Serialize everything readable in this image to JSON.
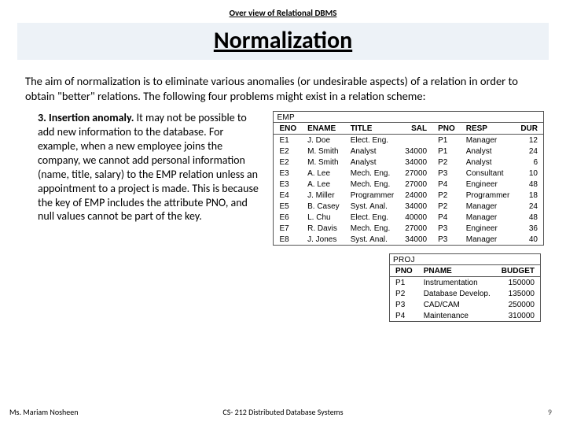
{
  "header": {
    "overview": "Over view of Relational DBMS"
  },
  "title": "Normalization",
  "intro": "The aim of normalization is to eliminate various anomalies (or undesirable aspects) of a relation in order to obtain \"better\" relations. The following four problems might exist in a relation scheme:",
  "anomaly": {
    "lead": "3. Insertion anomaly.",
    "body": " It may not be possible to add new information to the database. For example, when a new employee joins the company, we cannot add personal information (name, title, salary) to the EMP relation unless an appointment to a project is made. This is because the key of EMP includes the attribute PNO, and null values cannot be part of the key."
  },
  "emp": {
    "caption": "EMP",
    "headers": [
      "ENO",
      "ENAME",
      "TITLE",
      "SAL",
      "PNO",
      "RESP",
      "DUR"
    ],
    "rows": [
      [
        "E1",
        "J. Doe",
        "Elect. Eng.",
        "",
        "P1",
        "Manager",
        "12"
      ],
      [
        "E2",
        "M. Smith",
        "Analyst",
        "34000",
        "P1",
        "Analyst",
        "24"
      ],
      [
        "E2",
        "M. Smith",
        "Analyst",
        "34000",
        "P2",
        "Analyst",
        "6"
      ],
      [
        "E3",
        "A. Lee",
        "Mech. Eng.",
        "27000",
        "P3",
        "Consultant",
        "10"
      ],
      [
        "E3",
        "A. Lee",
        "Mech. Eng.",
        "27000",
        "P4",
        "Engineer",
        "48"
      ],
      [
        "E4",
        "J. Miller",
        "Programmer",
        "24000",
        "P2",
        "Programmer",
        "18"
      ],
      [
        "E5",
        "B. Casey",
        "Syst. Anal.",
        "34000",
        "P2",
        "Manager",
        "24"
      ],
      [
        "E6",
        "L. Chu",
        "Elect. Eng.",
        "40000",
        "P4",
        "Manager",
        "48"
      ],
      [
        "E7",
        "R. Davis",
        "Mech. Eng.",
        "27000",
        "P3",
        "Engineer",
        "36"
      ],
      [
        "E8",
        "J. Jones",
        "Syst. Anal.",
        "34000",
        "P3",
        "Manager",
        "40"
      ]
    ]
  },
  "proj": {
    "caption": "PROJ",
    "headers": [
      "PNO",
      "PNAME",
      "BUDGET"
    ],
    "rows": [
      [
        "P1",
        "Instrumentation",
        "150000"
      ],
      [
        "P2",
        "Database Develop.",
        "135000"
      ],
      [
        "P3",
        "CAD/CAM",
        "250000"
      ],
      [
        "P4",
        "Maintenance",
        "310000"
      ]
    ]
  },
  "footer": {
    "left": "Ms. Mariam Nosheen",
    "center": "CS- 212 Distributed Database Systems",
    "pageno": "9"
  },
  "chart_data": [
    {
      "type": "table",
      "title": "EMP",
      "headers": [
        "ENO",
        "ENAME",
        "TITLE",
        "SAL",
        "PNO",
        "RESP",
        "DUR"
      ],
      "rows": [
        [
          "E1",
          "J. Doe",
          "Elect. Eng.",
          null,
          "P1",
          "Manager",
          12
        ],
        [
          "E2",
          "M. Smith",
          "Analyst",
          34000,
          "P1",
          "Analyst",
          24
        ],
        [
          "E2",
          "M. Smith",
          "Analyst",
          34000,
          "P2",
          "Analyst",
          6
        ],
        [
          "E3",
          "A. Lee",
          "Mech. Eng.",
          27000,
          "P3",
          "Consultant",
          10
        ],
        [
          "E3",
          "A. Lee",
          "Mech. Eng.",
          27000,
          "P4",
          "Engineer",
          48
        ],
        [
          "E4",
          "J. Miller",
          "Programmer",
          24000,
          "P2",
          "Programmer",
          18
        ],
        [
          "E5",
          "B. Casey",
          "Syst. Anal.",
          34000,
          "P2",
          "Manager",
          24
        ],
        [
          "E6",
          "L. Chu",
          "Elect. Eng.",
          40000,
          "P4",
          "Manager",
          48
        ],
        [
          "E7",
          "R. Davis",
          "Mech. Eng.",
          27000,
          "P3",
          "Engineer",
          36
        ],
        [
          "E8",
          "J. Jones",
          "Syst. Anal.",
          34000,
          "P3",
          "Manager",
          40
        ]
      ]
    },
    {
      "type": "table",
      "title": "PROJ",
      "headers": [
        "PNO",
        "PNAME",
        "BUDGET"
      ],
      "rows": [
        [
          "P1",
          "Instrumentation",
          150000
        ],
        [
          "P2",
          "Database Develop.",
          135000
        ],
        [
          "P3",
          "CAD/CAM",
          250000
        ],
        [
          "P4",
          "Maintenance",
          310000
        ]
      ]
    }
  ]
}
